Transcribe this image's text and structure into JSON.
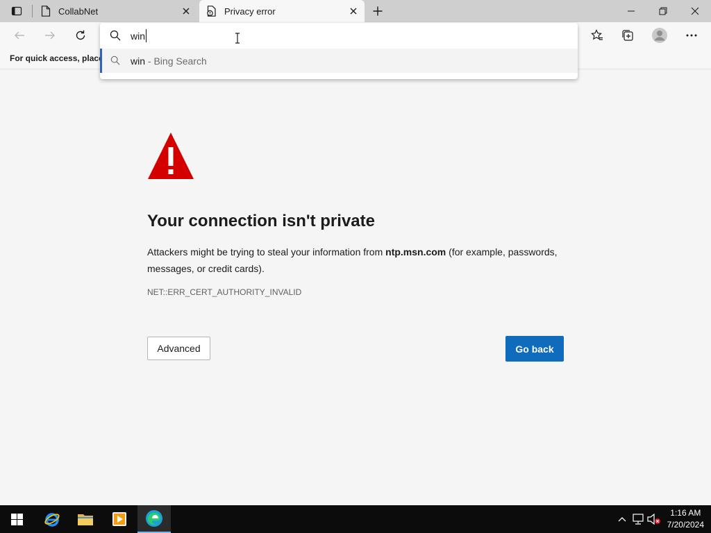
{
  "tabs": [
    {
      "title": "CollabNet",
      "icon": "page-icon",
      "active": false
    },
    {
      "title": "Privacy error",
      "icon": "privacy-error-icon",
      "active": true
    }
  ],
  "address_bar": {
    "query": "win"
  },
  "suggestions": [
    {
      "main": "win",
      "sub": " - Bing Search",
      "icon": "search-icon"
    }
  ],
  "favorites_bar": {
    "text": "For quick access, place y"
  },
  "error_page": {
    "headline": "Your connection isn't private",
    "desc_before": "Attackers might be trying to steal your information from ",
    "domain": "ntp.msn.com",
    "desc_after": " (for example, passwords, messages, or credit cards).",
    "error_code": "NET::ERR_CERT_AUTHORITY_INVALID",
    "advanced_label": "Advanced",
    "go_back_label": "Go back"
  },
  "taskbar": {
    "time": "1:16 AM",
    "date": "7/20/2024",
    "apps": [
      "start-button",
      "internet-explorer",
      "file-explorer",
      "media-player",
      "edge-browser"
    ]
  },
  "colors": {
    "accent": "#0f6cbd",
    "warning_red": "#d40000",
    "suggest_bar": "#2f63b8",
    "taskbar": "#0c0c0c"
  }
}
